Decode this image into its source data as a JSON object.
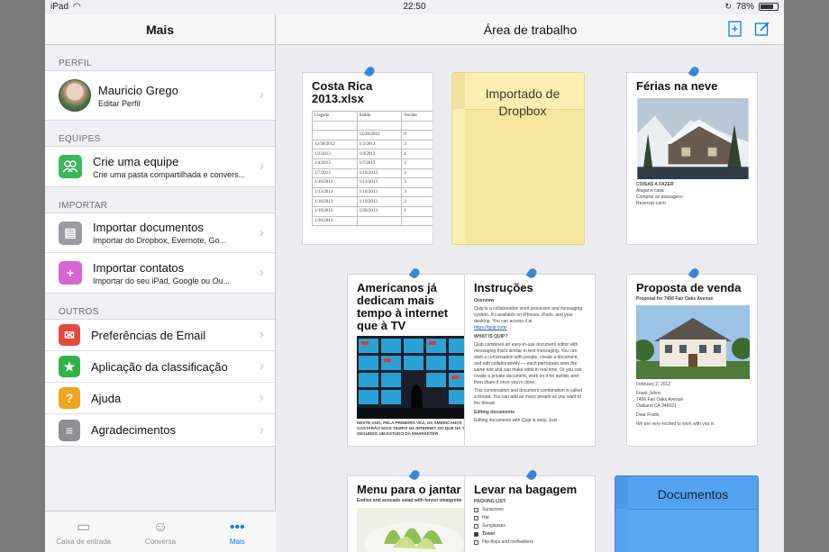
{
  "statusbar": {
    "device": "iPad",
    "time": "22:50",
    "battery": "78%",
    "battery_level": 0.78
  },
  "sidebar": {
    "title": "Mais",
    "sections": {
      "perfil": "PERFIL",
      "equipes": "EQUIPES",
      "importar": "IMPORTAR",
      "outros": "OUTROS"
    },
    "profile": {
      "name": "Mauricio Grego",
      "subtitle": "Editar Perfil"
    },
    "team": {
      "title": "Crie uma equipe",
      "subtitle": "Crie uma pasta compartilhada e convers..."
    },
    "import_docs": {
      "title": "Importar documentos",
      "subtitle": "Importar do Dropbox, Evernote, Go..."
    },
    "import_contacts": {
      "title": "Importar contatos",
      "subtitle": "Importar do seu iPad, Google ou Ou..."
    },
    "others": [
      {
        "label": "Preferências de Email",
        "icon": "mail-icon",
        "color": "#e5473d"
      },
      {
        "label": "Aplicação da classificação",
        "icon": "star-icon",
        "color": "#2fb24c"
      },
      {
        "label": "Ajuda",
        "icon": "help-icon",
        "color": "#f0a31c"
      },
      {
        "label": "Agradecimentos",
        "icon": "document-icon",
        "color": "#8e8e93"
      }
    ],
    "tabs": [
      {
        "label": "Caixa de entrada",
        "icon": "inbox-icon"
      },
      {
        "label": "Conversa",
        "icon": "people-icon"
      },
      {
        "label": "Mais",
        "icon": "more-icon"
      }
    ]
  },
  "main": {
    "title": "Área de trabalho",
    "cards": {
      "costa_rica": {
        "title": "Costa Rica 2013.xlsx",
        "headers": [
          "Llegada",
          "Salida",
          "Noches"
        ],
        "rows": [
          [
            "",
            "12/30/2012",
            "0"
          ],
          [
            "12/30/2012",
            "1/2/2013",
            "3"
          ],
          [
            "1/2/2013",
            "1/4/2013",
            "4"
          ],
          [
            "1/4/2013",
            "1/7/2013",
            "3"
          ],
          [
            "1/7/2013",
            "1/10/2013",
            "3"
          ],
          [
            "1/10/2013",
            "1/13/2013",
            "3"
          ],
          [
            "1/13/2013",
            "1/16/2013",
            "3"
          ],
          [
            "1/16/2013",
            "1/19/2013",
            "3"
          ],
          [
            "1/19/2013",
            "1/20/2013",
            "1"
          ],
          [
            "1/20/2013",
            "",
            ""
          ]
        ]
      },
      "dropbox_folder": {
        "title": "Importado de Dropbox"
      },
      "ferias": {
        "title": "Férias na neve",
        "todo_heading": "COISAS A FAZER",
        "todo": [
          "Alugar a casa",
          "Comprar as passagens",
          "Reservar carro"
        ]
      },
      "americanos": {
        "title": "Americanos já dedicam mais tempo à internet que à TV",
        "caption": "NESTE ANO, PELA PRIMEIRA VEZ, OS AMERICANOS GASTARÃO MAIS TEMPO NA INTERNET DO QUE NA TV, SEGUNDO UM ESTUDO DA EMARKETER"
      },
      "instrucoes": {
        "title": "Instruções",
        "overview": "Overview",
        "p1": "Quip is a collaborative word processor and messaging system. It's available on iPhones, iPads, and your desktop. You can access it at",
        "link": "https://quip.com/",
        "what": "WHAT IS QUIP?",
        "p2": "Quip combines an easy-to-use document editor with messaging that's similar to text messaging. You can start a conversation with people, create a document, and edit collaboratively — each participant sees the same text and can make edits in real time. Or you can create a private document, work on it for awhile, and then share it once you're done.",
        "p3": "This conversation and document combination is called a thread. You can add as many people as you want to the thread.",
        "editing": "Editing documents",
        "p4": "Editing documents with Quip is easy. Just"
      },
      "proposta": {
        "title": "Proposta de venda",
        "subtitle": "Proposal for 7456 Fair Oaks Avenue",
        "date": "February 2, 2012",
        "address": [
          "Frank Johns",
          "7456 Fair Oaks Avenue",
          "Oakland CA 946021"
        ],
        "greeting": "Dear Frank,",
        "body": "We are very excited to work with you in"
      },
      "menu": {
        "title": "Menu para o jantar",
        "subtitle": "Endive and avocado salad with fennel vinaigrette"
      },
      "bagagem": {
        "title": "Levar na bagagem",
        "heading": "PACKING LIST:",
        "items": [
          {
            "label": "Sunscreen",
            "checked": false
          },
          {
            "label": "Hat",
            "checked": false
          },
          {
            "label": "Sunglasses",
            "checked": false
          },
          {
            "label": "Towel",
            "checked": true
          },
          {
            "label": "Flip-flops and reefwalkers",
            "checked": false
          }
        ]
      },
      "documentos_folder": {
        "title": "Documentos"
      }
    }
  }
}
